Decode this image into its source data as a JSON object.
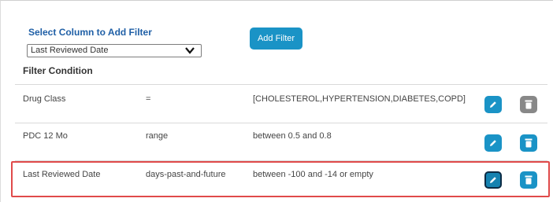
{
  "filter_form": {
    "select_label": "Select Column to Add Filter",
    "selected_column": "Last Reviewed Date",
    "add_filter_label": "Add Filter",
    "condition_heading": "Filter Condition"
  },
  "filters": [
    {
      "column": "Drug Class",
      "operator": "=",
      "value": "[CHOLESTEROL,HYPERTENSION,DIABETES,COPD]",
      "delete_enabled": false
    },
    {
      "column": "PDC 12 Mo",
      "operator": "range",
      "value": "between 0.5 and 0.8",
      "delete_enabled": true
    },
    {
      "column": "Last Reviewed Date",
      "operator": "days-past-and-future",
      "value": "between -100 and -14 or empty",
      "delete_enabled": true,
      "highlighted": true
    }
  ],
  "colors": {
    "accent": "#1a93c6",
    "label_blue": "#1f5fa6",
    "disabled_gray": "#888888",
    "highlight_red": "#e04a4a"
  },
  "icons": {
    "dropdown": "chevron-down-icon",
    "edit": "pencil-icon",
    "delete": "trash-icon"
  }
}
